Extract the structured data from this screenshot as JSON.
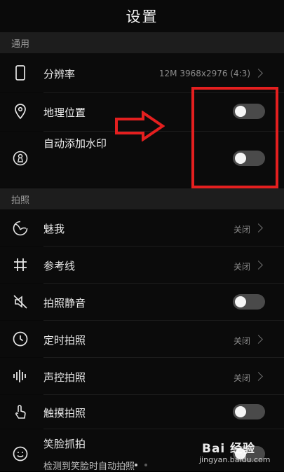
{
  "header": {
    "title": "设置"
  },
  "sections": {
    "general": {
      "title": "通用"
    },
    "photo": {
      "title": "拍照"
    }
  },
  "general_items": [
    {
      "label": "分辨率",
      "value": "12M 3968x2976 (4:3)",
      "icon": "phone-outline-icon",
      "control": "chevron"
    },
    {
      "label": "地理位置",
      "icon": "location-pin-icon",
      "control": "toggle",
      "on": false
    },
    {
      "label": "自动添加水印",
      "icon": "watermark-stamp-icon",
      "control": "toggle",
      "on": false
    }
  ],
  "photo_items": [
    {
      "label": "魅我",
      "value": "关闭",
      "icon": "beauty-face-icon",
      "control": "chevron"
    },
    {
      "label": "参考线",
      "value": "关闭",
      "icon": "grid-hash-icon",
      "control": "chevron"
    },
    {
      "label": "拍照静音",
      "icon": "mute-speaker-icon",
      "control": "toggle",
      "on": false
    },
    {
      "label": "定时拍照",
      "value": "关闭",
      "icon": "timer-clock-icon",
      "control": "chevron"
    },
    {
      "label": "声控拍照",
      "value": "关闭",
      "icon": "voice-waveform-icon",
      "control": "chevron"
    },
    {
      "label": "触摸拍照",
      "icon": "touch-finger-icon",
      "control": "toggle",
      "on": false
    },
    {
      "label": "笑脸抓拍",
      "sub": "检测到笑脸时自动拍照",
      "icon": "smile-face-icon",
      "control": "toggle",
      "on": false
    }
  ],
  "watermark": {
    "brand": "Bai 经验",
    "site": "jingyan.baidu.com"
  },
  "colors": {
    "highlight": "#e41f1f",
    "toggle_off": "#4a4a4a",
    "section_bg": "#1d1d1d"
  }
}
